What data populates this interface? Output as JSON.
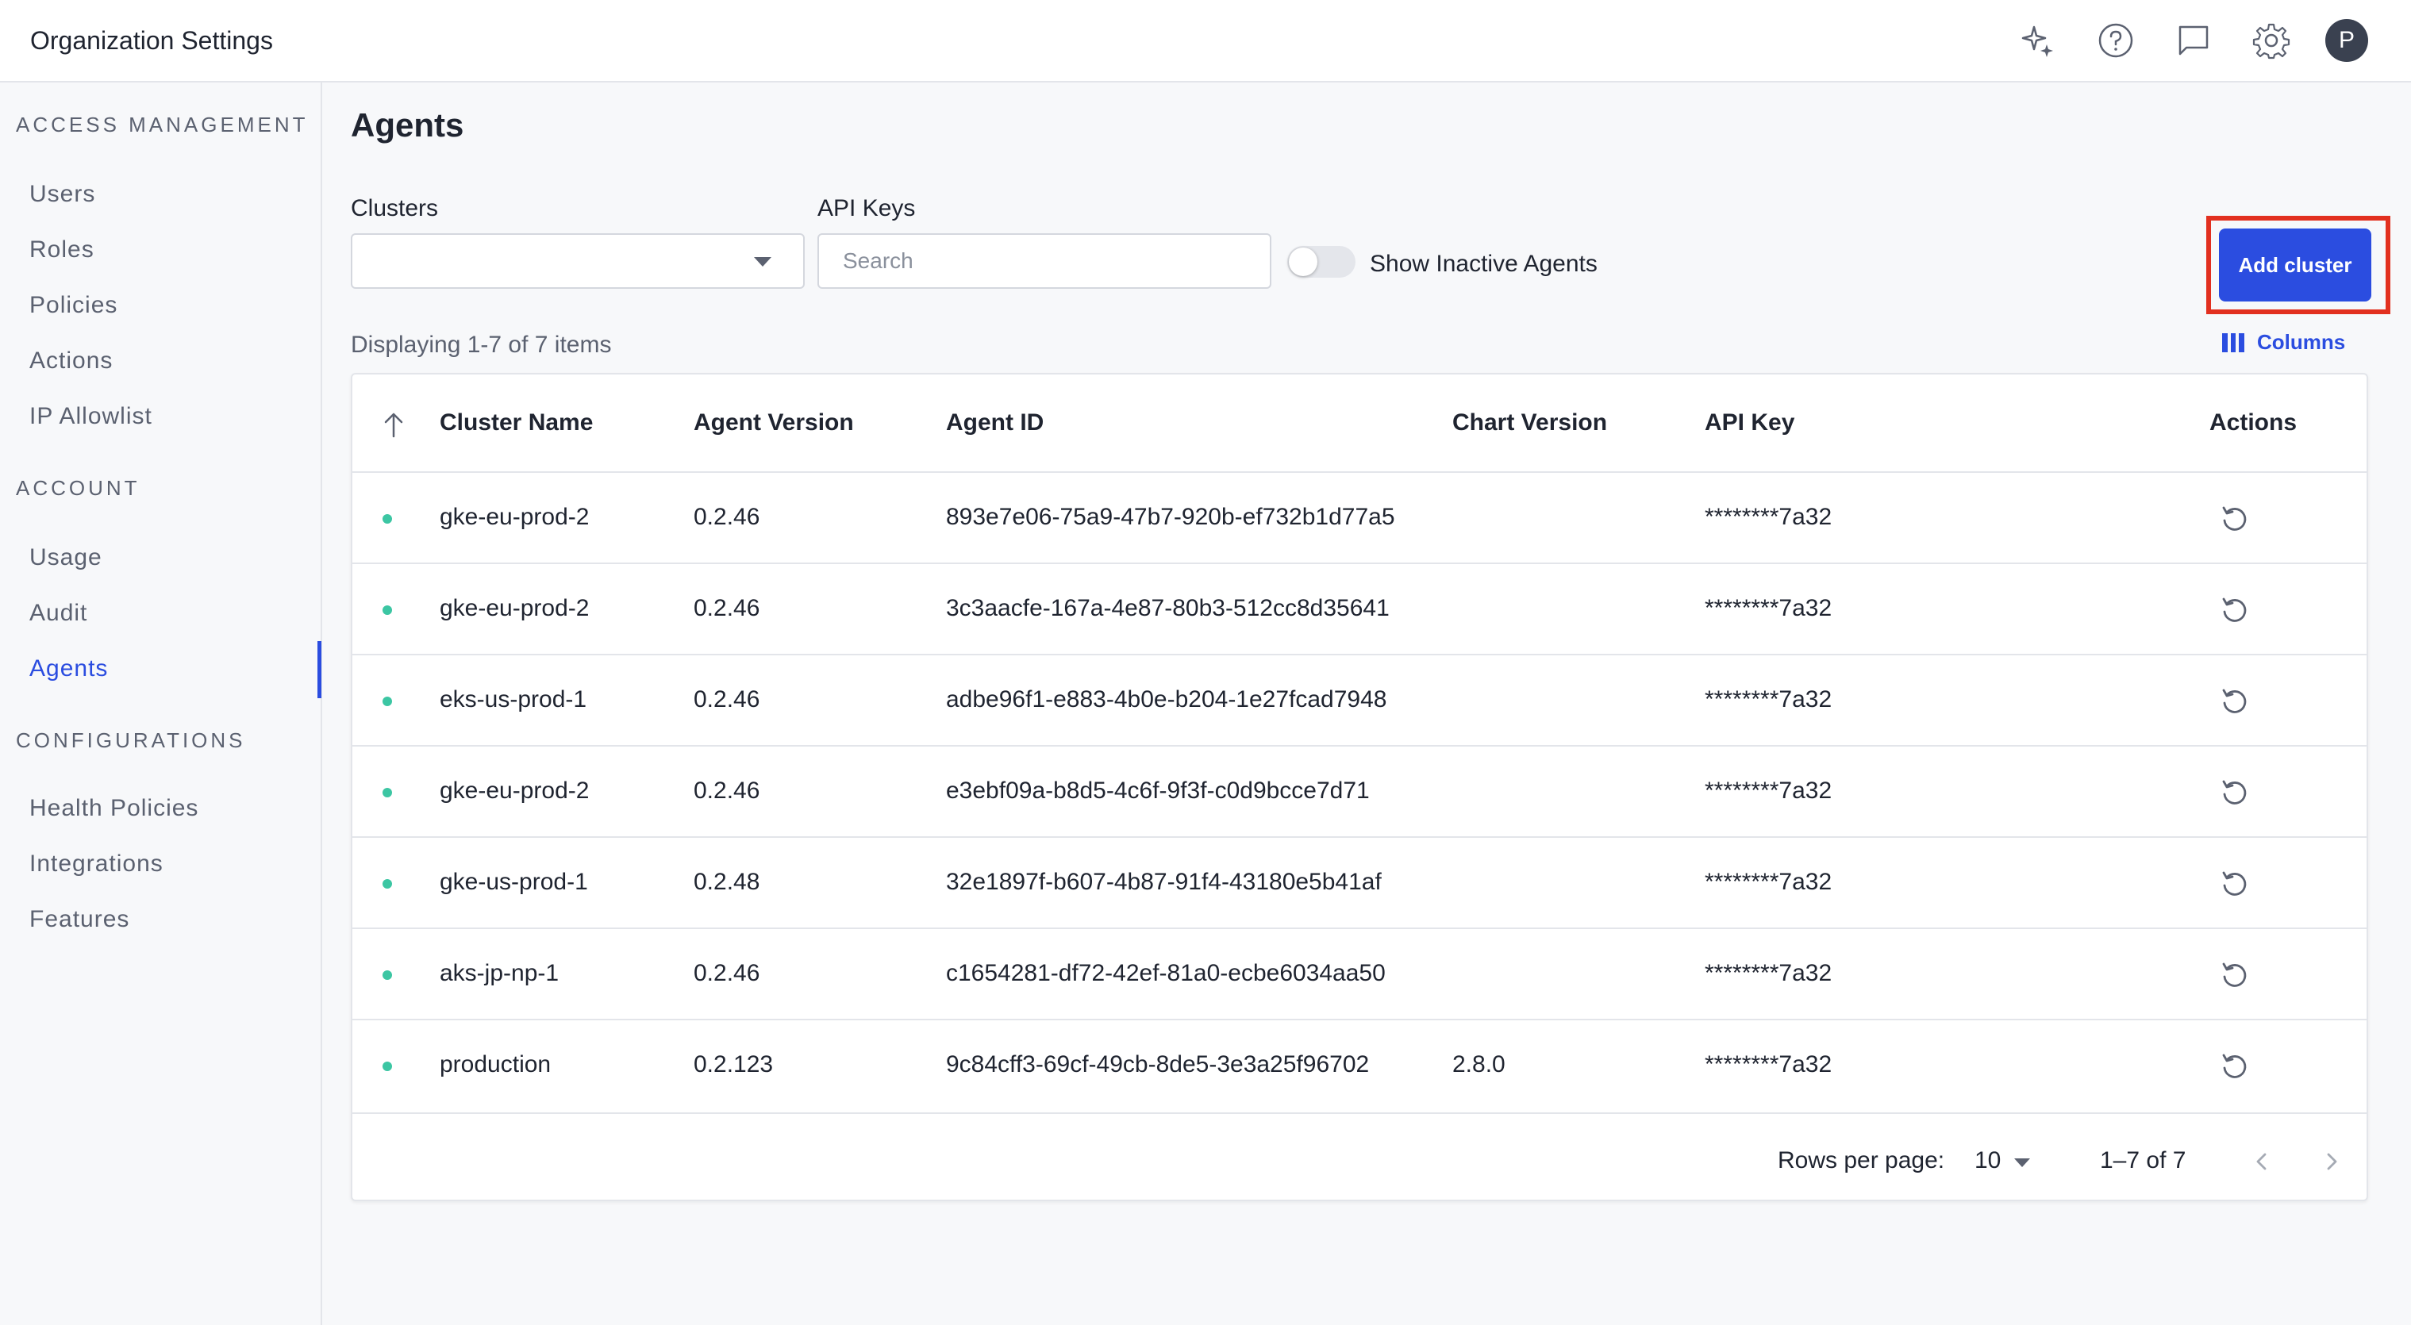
{
  "header": {
    "title": "Organization Settings",
    "icons": [
      "sparkle-icon",
      "help-icon",
      "chat-icon",
      "gear-icon"
    ],
    "avatar_initial": "P"
  },
  "sidebar": {
    "sections": [
      {
        "title": "ACCESS MANAGEMENT",
        "items": [
          "Users",
          "Roles",
          "Policies",
          "Actions",
          "IP Allowlist"
        ]
      },
      {
        "title": "ACCOUNT",
        "items": [
          "Usage",
          "Audit",
          "Agents"
        ]
      },
      {
        "title": "CONFIGURATIONS",
        "items": [
          "Health Policies",
          "Integrations",
          "Features"
        ]
      }
    ],
    "active_item": "Agents"
  },
  "main": {
    "title": "Agents",
    "filters": {
      "clusters_label": "Clusters",
      "clusters_value": "",
      "api_keys_label": "API Keys",
      "api_keys_placeholder": "Search",
      "toggle_label": "Show Inactive Agents",
      "toggle_on": false
    },
    "add_button": "Add cluster",
    "display_count": "Displaying 1-7 of 7 items",
    "columns_button": "Columns",
    "table": {
      "headers": [
        "Cluster Name",
        "Agent Version",
        "Agent ID",
        "Chart Version",
        "API Key",
        "Actions"
      ],
      "rows": [
        {
          "cluster": "gke-eu-prod-2",
          "version": "0.2.46",
          "id": "893e7e06-75a9-47b7-920b-ef732b1d77a5",
          "chart": "",
          "key": "********7a32"
        },
        {
          "cluster": "gke-eu-prod-2",
          "version": "0.2.46",
          "id": "3c3aacfe-167a-4e87-80b3-512cc8d35641",
          "chart": "",
          "key": "********7a32"
        },
        {
          "cluster": "eks-us-prod-1",
          "version": "0.2.46",
          "id": "adbe96f1-e883-4b0e-b204-1e27fcad7948",
          "chart": "",
          "key": "********7a32"
        },
        {
          "cluster": "gke-eu-prod-2",
          "version": "0.2.46",
          "id": "e3ebf09a-b8d5-4c6f-9f3f-c0d9bcce7d71",
          "chart": "",
          "key": "********7a32"
        },
        {
          "cluster": "gke-us-prod-1",
          "version": "0.2.48",
          "id": "32e1897f-b607-4b87-91f4-43180e5b41af",
          "chart": "",
          "key": "********7a32"
        },
        {
          "cluster": "aks-jp-np-1",
          "version": "0.2.46",
          "id": "c1654281-df72-42ef-81a0-ecbe6034aa50",
          "chart": "",
          "key": "********7a32"
        },
        {
          "cluster": "production",
          "version": "0.2.123",
          "id": "9c84cff3-69cf-49cb-8de5-3e3a25f96702",
          "chart": "2.8.0",
          "key": "********7a32"
        }
      ]
    },
    "pagination": {
      "rows_per_page_label": "Rows per page:",
      "rows_per_page": "10",
      "range": "1–7 of 7"
    }
  },
  "colors": {
    "accent": "#2b4de0",
    "highlight_frame": "#e2301f",
    "status_active": "#3cc6a3"
  }
}
